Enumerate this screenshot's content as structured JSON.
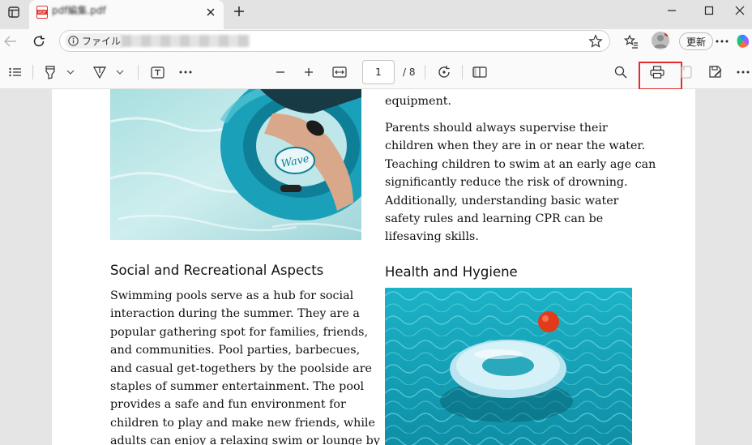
{
  "browser": {
    "tab_title": "pdf編集.pdf",
    "address": {
      "chip_label": "ファイル",
      "url": ""
    },
    "update_label": "更新"
  },
  "pdf_toolbar": {
    "current_page": "1",
    "total_pages": "/ 8"
  },
  "document": {
    "right_intro": "equipment.",
    "right_para": [
      "Parents should always supervise their",
      "children when they are in or near the water.",
      "Teaching children to swim at an early age can",
      "significantly reduce the risk of drowning.",
      "Additionally, understanding basic water",
      "safety rules and learning CPR can be",
      "lifesaving skills."
    ],
    "left_heading": "Social and Recreational Aspects",
    "right_heading": "Health and Hygiene",
    "left_para": [
      "Swimming pools serve as a hub for social",
      "interaction during the summer. They are a",
      "popular gathering spot for families, friends,",
      "and communities. Pool parties, barbecues,",
      "and casual get-togethers by the poolside are",
      "staples of summer entertainment. The pool",
      "provides a safe and fun environment for",
      "children to play and make new friends, while",
      "adults can enjoy a relaxing swim or lounge by"
    ],
    "float_text": "Wave"
  },
  "colors": {
    "highlight": "#e32b2b",
    "water": "#2fb3c6",
    "float_red": "#e23b1a"
  }
}
